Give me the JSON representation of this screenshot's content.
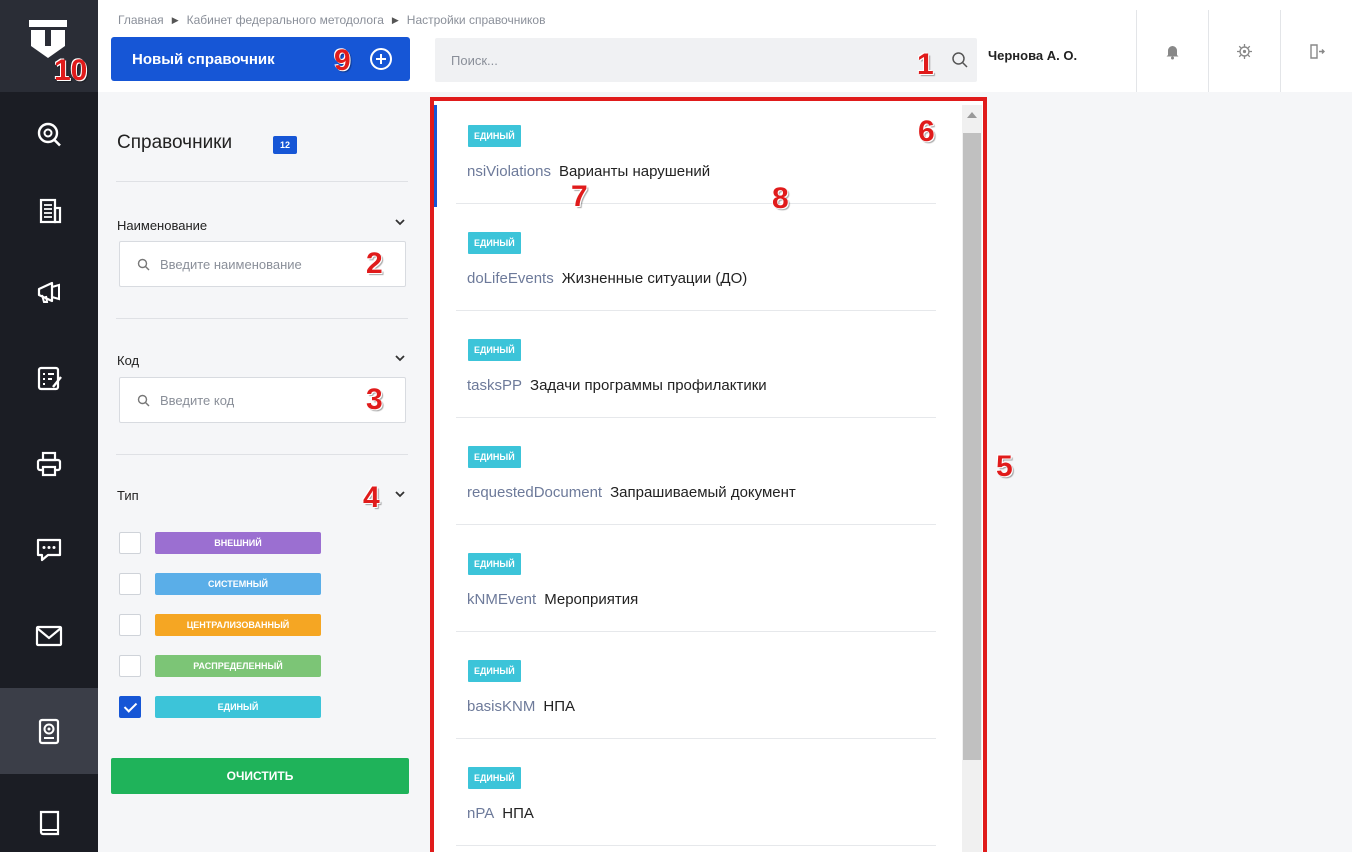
{
  "breadcrumb": [
    "Главная",
    "Кабинет федерального методолога",
    "Настройки справочников"
  ],
  "header": {
    "new_button_label": "Новый справочник",
    "search_placeholder": "Поиск...",
    "user_name": "Чернова А. О."
  },
  "rail": {
    "items": [
      "logo-icon",
      "search-glasses-icon",
      "building-icon",
      "megaphone-icon",
      "checklist-icon",
      "printer-icon",
      "chat-icon",
      "mail-icon",
      "reference-settings-icon",
      "book-icon"
    ],
    "active_index": 8
  },
  "filters": {
    "title": "Справочники",
    "count": "12",
    "name_label": "Наименование",
    "name_placeholder": "Введите наименование",
    "code_label": "Код",
    "code_placeholder": "Введите код",
    "type_label": "Тип",
    "types": [
      {
        "label": "внешний",
        "color": "#9b6fd1",
        "checked": false
      },
      {
        "label": "системный",
        "color": "#5aaee8",
        "checked": false
      },
      {
        "label": "централизованный",
        "color": "#f5a623",
        "checked": false
      },
      {
        "label": "распределенный",
        "color": "#7cc576",
        "checked": false
      },
      {
        "label": "единый",
        "color": "#3cc4d9",
        "checked": true
      }
    ],
    "clear_label": "очистить"
  },
  "list": [
    {
      "type": "единый",
      "code": "nsiViolations",
      "name": "Варианты нарушений"
    },
    {
      "type": "единый",
      "code": "doLifeEvents",
      "name": "Жизненные ситуации (ДО)"
    },
    {
      "type": "единый",
      "code": "tasksPP",
      "name": "Задачи программы профилактики"
    },
    {
      "type": "единый",
      "code": "requestedDocument",
      "name": "Запрашиваемый документ"
    },
    {
      "type": "единый",
      "code": "kNMEvent",
      "name": "Мероприятия"
    },
    {
      "type": "единый",
      "code": "basisKNM",
      "name": "НПА"
    },
    {
      "type": "единый",
      "code": "nPA",
      "name": "НПА"
    }
  ],
  "callouts": [
    "1",
    "2",
    "3",
    "4",
    "5",
    "6",
    "7",
    "8",
    "9",
    "10"
  ],
  "colors": {
    "primary": "#1656d6",
    "success": "#1fb35a",
    "annotation": "#e01b1b",
    "rail": "#1b1d24"
  }
}
